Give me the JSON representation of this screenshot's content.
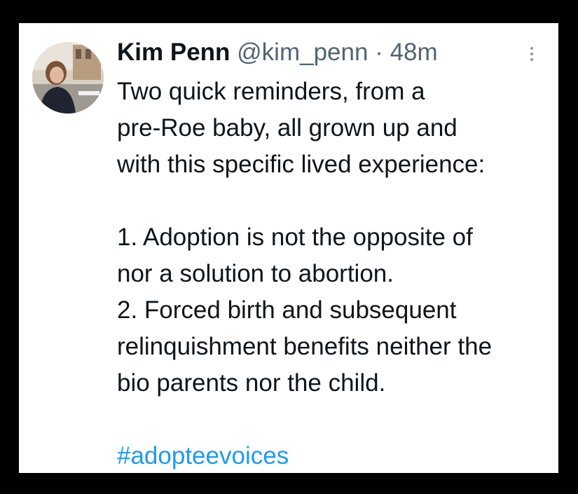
{
  "tweet": {
    "author_name": "Kim Penn",
    "handle": "@kim_penn",
    "separator": "·",
    "time": "48m",
    "intro_lines": [
      "Two quick reminders, from a",
      "pre-Roe baby, all grown up and",
      "with this specific lived experience:"
    ],
    "point1_lines": [
      "1. Adoption is not the opposite of",
      "nor a solution to abortion."
    ],
    "point2_lines": [
      "2. Forced birth and subsequent",
      "relinquishment benefits neither the",
      "bio parents nor the child."
    ],
    "hashtag": "#adopteevoices"
  },
  "colors": {
    "background": "#000000",
    "card": "#ffffff",
    "text": "#0f1419",
    "muted": "#536471",
    "link": "#1d9bf0"
  },
  "icons": {
    "more": "more-options-icon"
  }
}
